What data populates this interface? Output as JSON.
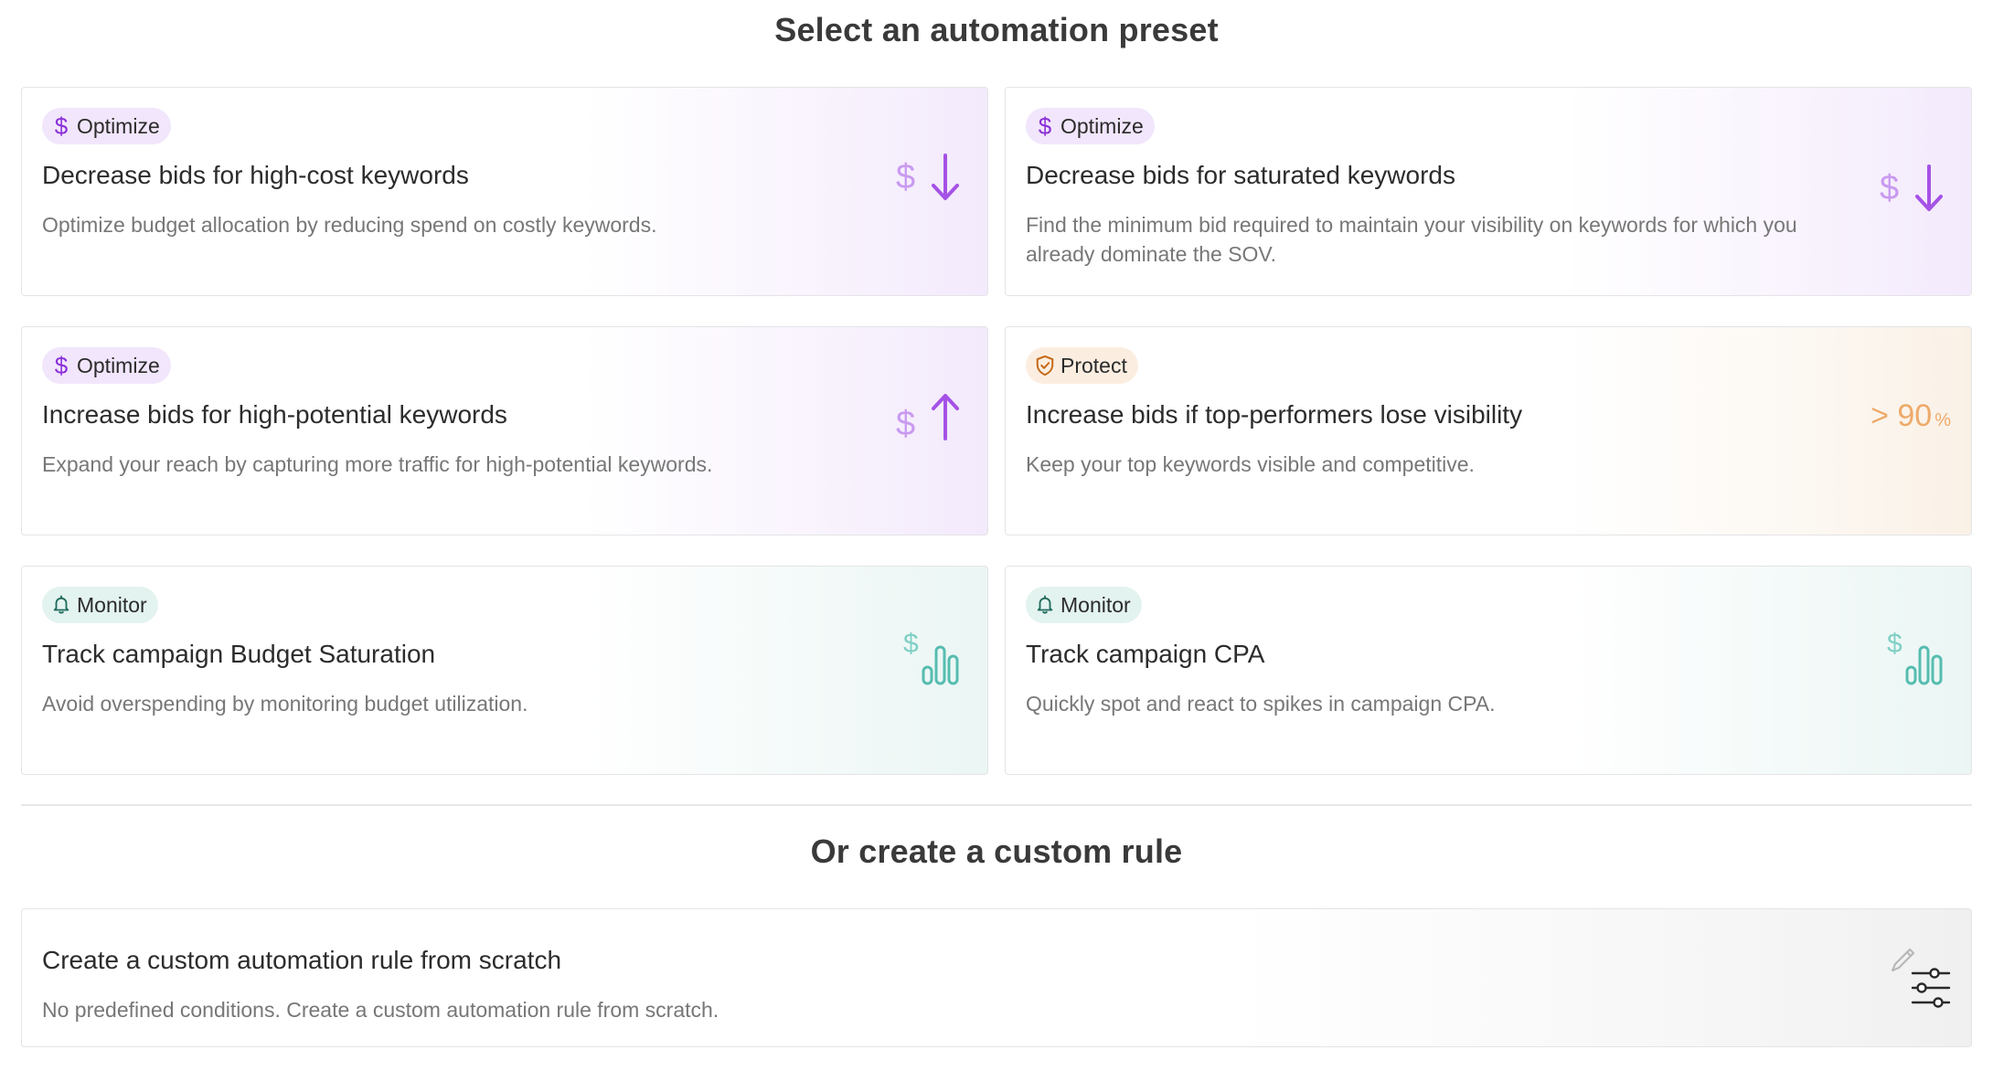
{
  "presets_heading": "Select an automation preset",
  "custom_heading": "Or create a custom rule",
  "colors": {
    "optimize_accent": "#8b2fd8",
    "optimize_icon": "#b66bea",
    "protect_accent": "#c66a18",
    "protect_icon": "#eeaa6a",
    "monitor_accent": "#1f6a5c",
    "monitor_icon": "#56bdb0"
  },
  "presets": [
    {
      "category": "Optimize",
      "category_icon": "dollar-icon",
      "title": "Decrease bids for high-cost keywords",
      "description": "Optimize budget allocation by reducing spend on costly keywords.",
      "icon": "dollar-down-icon"
    },
    {
      "category": "Optimize",
      "category_icon": "dollar-icon",
      "title": "Decrease bids for saturated keywords",
      "description": "Find the minimum bid required to maintain your visibility on keywords for which you already dominate the SOV.",
      "icon": "dollar-down-icon"
    },
    {
      "category": "Optimize",
      "category_icon": "dollar-icon",
      "title": "Increase bids for high-potential keywords",
      "description": "Expand your reach by capturing more traffic for high-potential keywords.",
      "icon": "dollar-up-icon"
    },
    {
      "category": "Protect",
      "category_icon": "shield-check-icon",
      "title": "Increase bids if top-performers lose visibility",
      "description": "Keep your top keywords visible and competitive.",
      "icon": "greater-than-90-percent-icon",
      "icon_text": "> 90",
      "icon_unit": "%"
    },
    {
      "category": "Monitor",
      "category_icon": "bell-icon",
      "title": "Track campaign Budget Saturation",
      "description": "Avoid overspending by monitoring budget utilization.",
      "icon": "dollar-bar-chart-icon"
    },
    {
      "category": "Monitor",
      "category_icon": "bell-icon",
      "title": "Track campaign CPA",
      "description": "Quickly spot and react to spikes in campaign CPA.",
      "icon": "dollar-bar-chart-icon"
    }
  ],
  "custom_rule": {
    "title": "Create a custom automation rule from scratch",
    "description": "No predefined conditions. Create a custom automation rule from scratch.",
    "icon": "pencil-sliders-icon"
  }
}
